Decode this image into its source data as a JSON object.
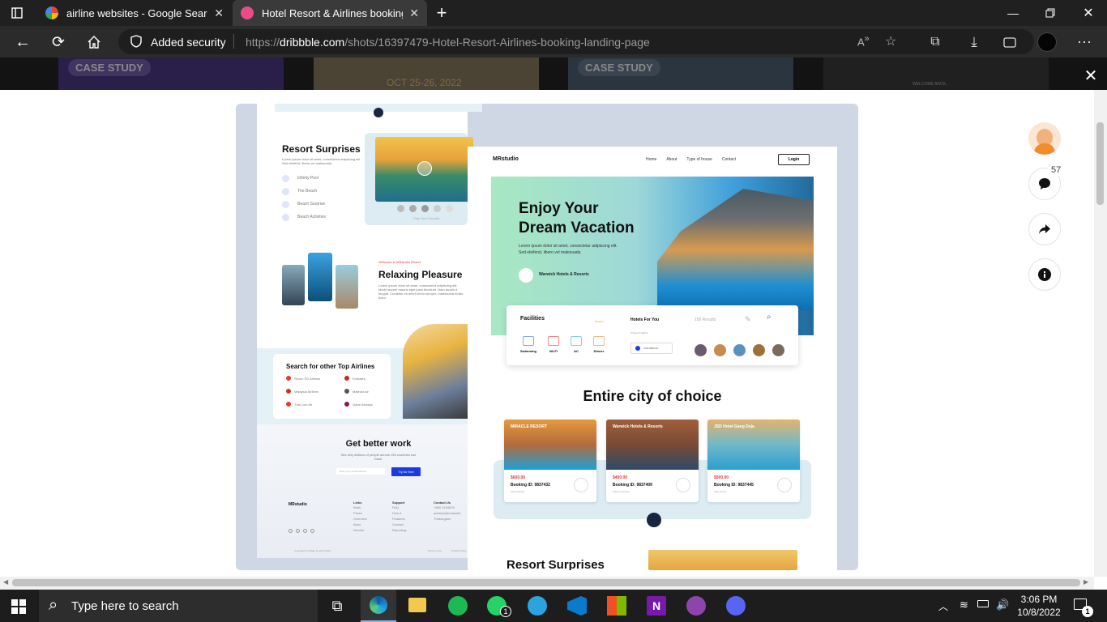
{
  "browser": {
    "tabs": [
      {
        "title": "airline websites - Google Search",
        "favicon": "google-icon",
        "active": false
      },
      {
        "title": "Hotel Resort & Airlines booking l",
        "favicon": "dribbble-icon",
        "active": true
      }
    ],
    "security_label": "Added security",
    "url_prefix": "https://",
    "url_domain": "dribbble.com",
    "url_path": "/shots/16397479-Hotel-Resort-Airlines-booking-landing-page"
  },
  "background_cards": [
    {
      "badge": "CASE STUDY"
    },
    {
      "date": "OCT 25-26, 2022"
    },
    {
      "badge": "CASE STUDY"
    },
    {
      "text": "WELCOME BACK,"
    }
  ],
  "shot_actions": {
    "comments_count": "57"
  },
  "left_design": {
    "resort_title": "Resort Surprises",
    "resort_desc": "Lorem ipsum dolor sit amet, consectetur adipiscing elit. Sed eleifend, libero vel malesuada",
    "resort_items": [
      "Infinity Pool",
      "The Beach",
      "Beach Surprise",
      "Beach Activities"
    ],
    "video_caption": "Play Your Favorite",
    "welcome_label": "Welcome to MRstudio Resort",
    "relax_title": "Relaxing Pleasure",
    "relax_desc": "Lorem ipsum dolor sit amet, consectetur adipiscing elit. Morbi laoreet mauris eget justo tincidunt. Nam iaculis a feugiat. Curabitur sit amet lorem semper, malesuada mollis dolor.",
    "airlines_title": "Search for other Top Airlines",
    "airlines": [
      "Simon SG Airlines",
      "Emirates",
      "Malaysia Airlines",
      "Malindo Air",
      "Thai Lion Air",
      "Qatar Airways"
    ],
    "better_title": "Get better work",
    "better_desc": "See why millions of people across 195 countries use Dash.",
    "email_placeholder": "Enter your email address",
    "try_button": "Try for free",
    "footer_brand": "MRstudio",
    "footer_cols": [
      {
        "title": "Links",
        "items": [
          "Work",
          "Prices",
          "Overview",
          "Abou",
          "Service"
        ]
      },
      {
        "title": "Support",
        "items": [
          "FAQ",
          "How it",
          "Features",
          "Contact",
          "Reporting"
        ]
      },
      {
        "title": "Contact Us",
        "items": [
          "+880 1234678",
          "address@mrstudio",
          "Thakurgaon"
        ]
      }
    ],
    "copyright": "Copyright & collage by @mrstudio",
    "terms": "Terms of use",
    "privacy": "Privacy Policy"
  },
  "right_design": {
    "brand": "MRstudio",
    "nav": [
      "Home",
      "About",
      "Type of house",
      "Contact"
    ],
    "login": "Login",
    "hero_title_1": "Enjoy Your",
    "hero_title_2": "Dream Vacation",
    "hero_desc_1": "Lorem ipsum dolor sit amet, consectetur adipiscing elit.",
    "hero_desc_2": "Sed eleifend, libero vel malesuada",
    "hotel_chain": "Warwick Hotels & Resorts",
    "facilities_title": "Facilities",
    "facilities_tag": "Vacation",
    "facilities": [
      "Swimming",
      "Wi-Fi",
      "AC",
      "Dinner"
    ],
    "hotels_for_you": "Hotels For You",
    "results": "150 Results",
    "stay": "5 Days 6 Nights",
    "price_small": "USD $500.00",
    "city_title": "Entire city of choice",
    "hotels": [
      {
        "name": "MIRACLE RESORT",
        "price": "$600.00",
        "booking": "Booking ID: 9837432",
        "loc": "Santa Beach"
      },
      {
        "name": "Warwick Hotels & Resorts",
        "price": "$400.00",
        "booking": "Booking ID: 9837409",
        "loc": "Warwick Hotels"
      },
      {
        "name": "JSD Hotel Gang Deja",
        "price": "$500.00",
        "booking": "Booking ID: 9837445",
        "loc": "JSD Hotels"
      }
    ],
    "resort_title_bottom": "Resort Surprises"
  },
  "taskbar": {
    "search_placeholder": "Type here to search",
    "time": "3:06 PM",
    "date": "10/8/2022",
    "whatsapp_badge": "1",
    "notif_badge": "1"
  },
  "colors": {
    "accent_blue": "#1b3be0",
    "hero_green": "#9fe3b8",
    "hero_blue": "#4fb0e8",
    "price_red": "#e53935",
    "chrome_dark": "#202020"
  }
}
